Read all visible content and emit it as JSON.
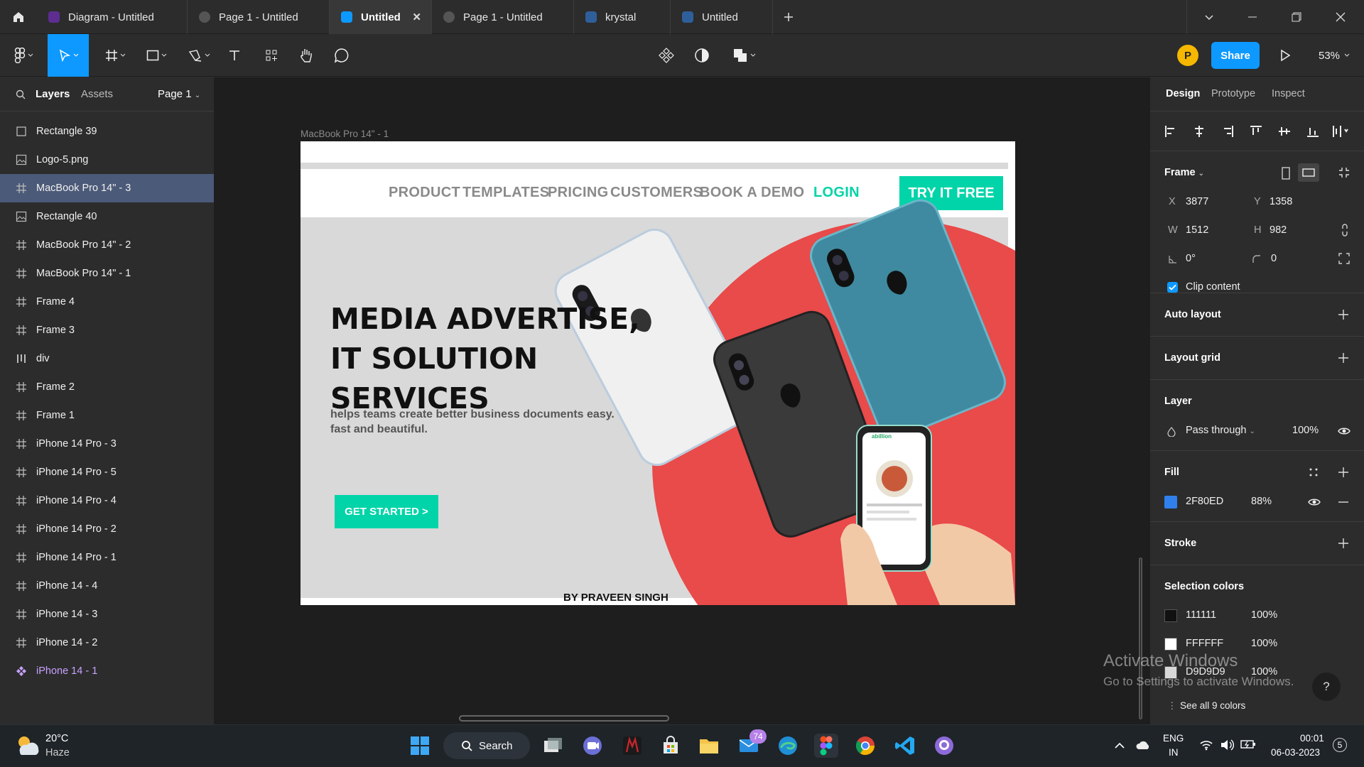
{
  "tabs": [
    {
      "label": "Diagram - Untitled",
      "icon": "figjam-icon",
      "color": "#7b3fb8"
    },
    {
      "label": "Page 1 - Untitled",
      "icon": "prototype-play-icon",
      "color": "#555555"
    },
    {
      "label": "Untitled",
      "icon": "figma-file-icon",
      "color": "#0d99ff",
      "active": true
    },
    {
      "label": "Page 1 - Untitled",
      "icon": "prototype-play-icon",
      "color": "#555555"
    },
    {
      "label": "krystal",
      "icon": "figma-file-icon",
      "color": "#2f6fb8"
    },
    {
      "label": "Untitled",
      "icon": "figma-file-icon",
      "color": "#2f6fb8"
    }
  ],
  "toolbar": {
    "user_initial": "P",
    "share_label": "Share",
    "zoom": "53%"
  },
  "left_panel": {
    "tabs": [
      "Layers",
      "Assets"
    ],
    "page": "Page 1",
    "layers": [
      {
        "name": "Rectangle 39",
        "icon": "rectangle-icon"
      },
      {
        "name": "Logo-5.png",
        "icon": "image-icon"
      },
      {
        "name": "MacBook Pro 14\" - 3",
        "icon": "frame-icon",
        "selected": true
      },
      {
        "name": "Rectangle 40",
        "icon": "image-icon"
      },
      {
        "name": "MacBook Pro 14\" - 2",
        "icon": "frame-icon"
      },
      {
        "name": "MacBook Pro 14\" - 1",
        "icon": "frame-icon"
      },
      {
        "name": "Frame 4",
        "icon": "frame-icon"
      },
      {
        "name": "Frame 3",
        "icon": "frame-icon"
      },
      {
        "name": "div",
        "icon": "auto-layout-icon"
      },
      {
        "name": "Frame 2",
        "icon": "frame-icon"
      },
      {
        "name": "Frame 1",
        "icon": "frame-icon"
      },
      {
        "name": "iPhone 14 Pro - 3",
        "icon": "frame-icon"
      },
      {
        "name": "iPhone 14 Pro - 5",
        "icon": "frame-icon"
      },
      {
        "name": "iPhone 14 Pro - 4",
        "icon": "frame-icon"
      },
      {
        "name": "iPhone 14 Pro - 2",
        "icon": "frame-icon"
      },
      {
        "name": "iPhone 14 Pro - 1",
        "icon": "frame-icon"
      },
      {
        "name": "iPhone 14 - 4",
        "icon": "frame-icon"
      },
      {
        "name": "iPhone 14 - 3",
        "icon": "frame-icon"
      },
      {
        "name": "iPhone 14 - 2",
        "icon": "frame-icon"
      },
      {
        "name": "iPhone 14 - 1",
        "icon": "component-icon",
        "component": true
      }
    ]
  },
  "canvas": {
    "frame_label": "MacBook Pro 14\" - 1",
    "nav": [
      "PRODUCT",
      "TEMPLATES",
      "PRICING",
      "CUSTOMERS",
      "BOOK A DEMO"
    ],
    "login": "LOGIN",
    "cta": "TRY IT FREE",
    "headline": [
      "MEDIA ADVERTISE,",
      "IT SOLUTION",
      "SERVICES"
    ],
    "subtext": [
      "helps teams create better business documents easy.",
      "fast and beautiful."
    ],
    "get_started": "GET STARTED >",
    "byline": "BY PRAVEEN SINGH",
    "phone_app_name": "abillion"
  },
  "right_panel": {
    "tabs": [
      "Design",
      "Prototype",
      "Inspect"
    ],
    "frame_title": "Frame",
    "x_label": "X",
    "x": "3877",
    "y_label": "Y",
    "y": "1358",
    "w_label": "W",
    "w": "1512",
    "h_label": "H",
    "h": "982",
    "rotation": "0°",
    "radius": "0",
    "clip_content": "Clip content",
    "auto_layout": "Auto layout",
    "layout_grid": "Layout grid",
    "layer_title": "Layer",
    "blend": "Pass through",
    "opacity": "100%",
    "fill_title": "Fill",
    "fill_hex": "2F80ED",
    "fill_opacity": "88%",
    "fill_color": "#2F80ED",
    "stroke_title": "Stroke",
    "selection_colors_title": "Selection colors",
    "selection_colors": [
      {
        "hex": "111111",
        "opacity": "100%",
        "color": "#111111"
      },
      {
        "hex": "FFFFFF",
        "opacity": "100%",
        "color": "#FFFFFF"
      },
      {
        "hex": "D9D9D9",
        "opacity": "100%",
        "color": "#D9D9D9"
      }
    ],
    "see_all": "See all 9 colors"
  },
  "watermark": {
    "line1": "Activate Windows",
    "line2": "Go to Settings to activate Windows."
  },
  "help": "?",
  "taskbar": {
    "temp": "20°C",
    "weather": "Haze",
    "search": "Search",
    "mail_badge": "74",
    "lang1": "ENG",
    "lang2": "IN",
    "time": "00:01",
    "date": "06-03-2023",
    "notif": "5"
  },
  "colors": {
    "accent": "#0d99ff",
    "brand_teal": "#00d4a8",
    "hero_red": "#e94a4a"
  }
}
